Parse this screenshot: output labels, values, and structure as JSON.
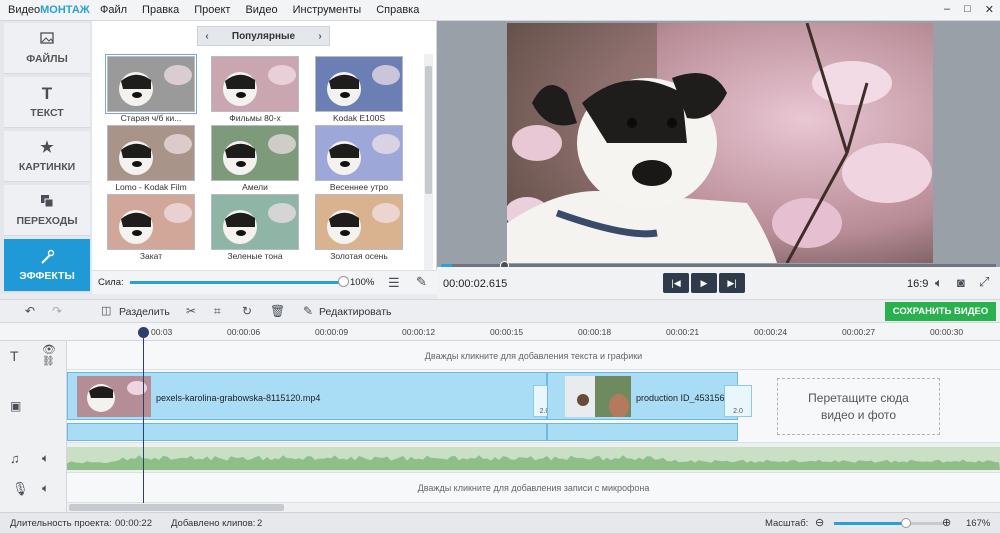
{
  "app": {
    "logo_part1": "Видео",
    "logo_part2": "МОНТАЖ"
  },
  "menu": [
    "Файл",
    "Правка",
    "Проект",
    "Видео",
    "Инструменты",
    "Справка"
  ],
  "window_controls": [
    "–",
    "□",
    "✕"
  ],
  "sidebar": [
    {
      "label": "ФАЙЛЫ",
      "icon": "image-icon"
    },
    {
      "label": "ТЕКСТ",
      "icon": "text-icon"
    },
    {
      "label": "КАРТИНКИ",
      "icon": "star-icon"
    },
    {
      "label": "ПЕРЕХОДЫ",
      "icon": "transitions-icon"
    },
    {
      "label": "ЭФФЕКТЫ",
      "icon": "magic-wand-icon"
    }
  ],
  "effects": {
    "category": "Популярные",
    "items": [
      "Старая ч/б ки...",
      "Фильмы 80-х",
      "Kodak E100S",
      "Lomo - Kodak Film",
      "Амели",
      "Весеннее утро",
      "Закат",
      "Зеленые тона",
      "Золотая осень"
    ],
    "force_label": "Сила:",
    "force_value": "100%",
    "force_level": 1.0
  },
  "preview": {
    "time": "00:00:02.615",
    "aspect": "16:9",
    "progress": 0.01
  },
  "toolbar": {
    "split": "Разделить",
    "edit": "Редактировать",
    "save": "СОХРАНИТЬ ВИДЕО"
  },
  "ruler": [
    "00:03",
    "00:00:06",
    "00:00:09",
    "00:00:12",
    "00:00:15",
    "00:00:18",
    "00:00:21",
    "00:00:24",
    "00:00:27",
    "00:00:30"
  ],
  "timeline": {
    "text_hint": "Дважды кликните для добавления текста и графики",
    "clip1": "pexels-karolina-grabowska-8115120.mp4",
    "clip2": "production ID_453156",
    "transition_dur": "2.0",
    "dropzone": "Перетащите сюда видео и фото",
    "mic_hint": "Дважды кликните для добавления записи с микрофона"
  },
  "status": {
    "duration_label": "Длительность проекта:",
    "duration": "00:00:22",
    "clips_label": "Добавлено клипов:",
    "clips": "2",
    "zoom_label": "Масштаб:",
    "zoom": "167%"
  }
}
